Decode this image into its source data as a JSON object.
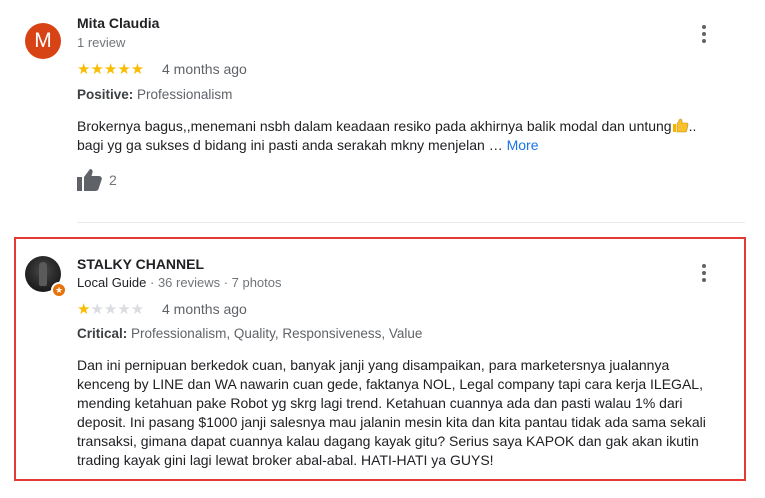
{
  "reviews": [
    {
      "avatar_letter": "M",
      "name": "Mita Claudia",
      "meta": "1 review",
      "rating": 5,
      "stars_text": "★★★★★",
      "date": "4 months ago",
      "tag_label": "Positive:",
      "tag_values": "Professionalism",
      "text_line1": "Brokernya bagus,,menemani nsbh dalam keadaan resiko pada akhirnya balik modal dan untung",
      "text_line1_tail": "..",
      "text_line2": "bagi yg ga sukses d bidang ini pasti anda serakah mkny menjelan …",
      "more_label": "More",
      "likes": "2"
    },
    {
      "name": "STALKY CHANNEL",
      "guide_label": "Local Guide",
      "meta": " · 36 reviews · 7 photos",
      "rating": 1,
      "star_on": "★",
      "star_off": "★★★★",
      "date": "4 months ago",
      "tag_label": "Critical:",
      "tag_values": "Professionalism, Quality, Responsiveness, Value",
      "text_lines": [
        "Dan ini pernipuan berkedok cuan, banyak janji yang disampaikan, para marketersnya jualannya",
        "kenceng by LINE dan WA nawarin cuan gede, faktanya NOL, Legal company tapi cara kerja ILEGAL,",
        "mending ketahuan pake Robot yg skrg lagi trend. Ketahuan cuannya ada dan pasti walau 1% dari",
        "deposit. Ini pasang $1000 janji salesnya mau jalanin mesin kita dan kita pantau tidak ada sama sekali",
        "transaksi, gimana dapat cuannya kalau dagang kayak gitu? Serius saya KAPOK dan gak akan ikutin",
        "trading kayak gini lagi lewat broker abal-abal. HATI-HATI ya GUYS!"
      ]
    }
  ],
  "colors": {
    "star": "#fbbc04",
    "star_empty": "#dadce0",
    "link": "#1a73e8",
    "highlight": "#e53935",
    "avatar_m": "#d84315"
  },
  "icons": {
    "menu": "more-vert-icon",
    "like": "thumb-up-icon",
    "badge": "local-guide-star-icon"
  }
}
